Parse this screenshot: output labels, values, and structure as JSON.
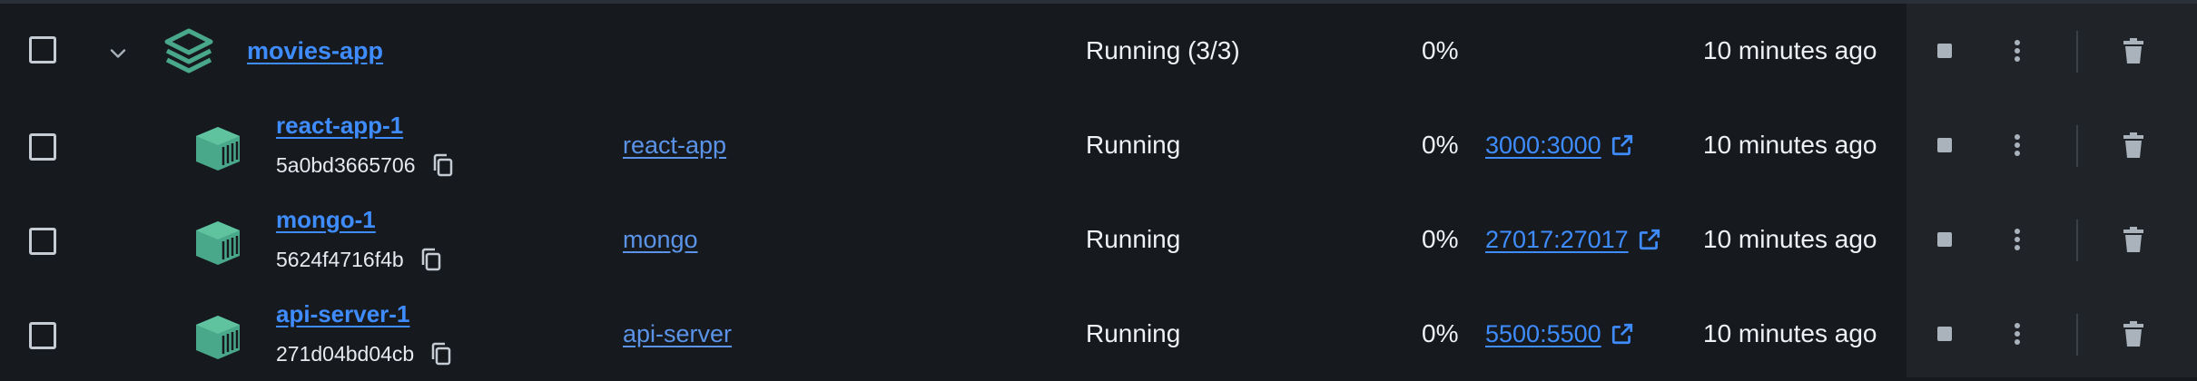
{
  "group": {
    "name": "movies-app",
    "status": "Running (3/3)",
    "cpu": "0%",
    "last_started": "10 minutes ago",
    "expanded": true
  },
  "containers": [
    {
      "name": "react-app-1",
      "id": "5a0bd3665706",
      "image": "react-app",
      "status": "Running",
      "cpu": "0%",
      "port": "3000:3000",
      "last_started": "10 minutes ago"
    },
    {
      "name": "mongo-1",
      "id": "5624f4716f4b",
      "image": "mongo",
      "status": "Running",
      "cpu": "0%",
      "port": "27017:27017",
      "last_started": "10 minutes ago"
    },
    {
      "name": "api-server-1",
      "id": "271d04bd04cb",
      "image": "api-server",
      "status": "Running",
      "cpu": "0%",
      "port": "5500:5500",
      "last_started": "10 minutes ago"
    }
  ],
  "colors": {
    "background": "#161a1f",
    "actions_background": "#202429",
    "link": "#3f8cff",
    "icon_teal": "#4aa88a",
    "text": "#eef1f5"
  },
  "icons": {
    "group": "stack-layers-icon",
    "container": "container-cube-icon",
    "expand": "chevron-down-icon",
    "copy": "copy-icon",
    "open_port": "external-link-icon",
    "stop": "stop-icon",
    "more": "kebab-menu-icon",
    "delete": "trash-icon"
  }
}
